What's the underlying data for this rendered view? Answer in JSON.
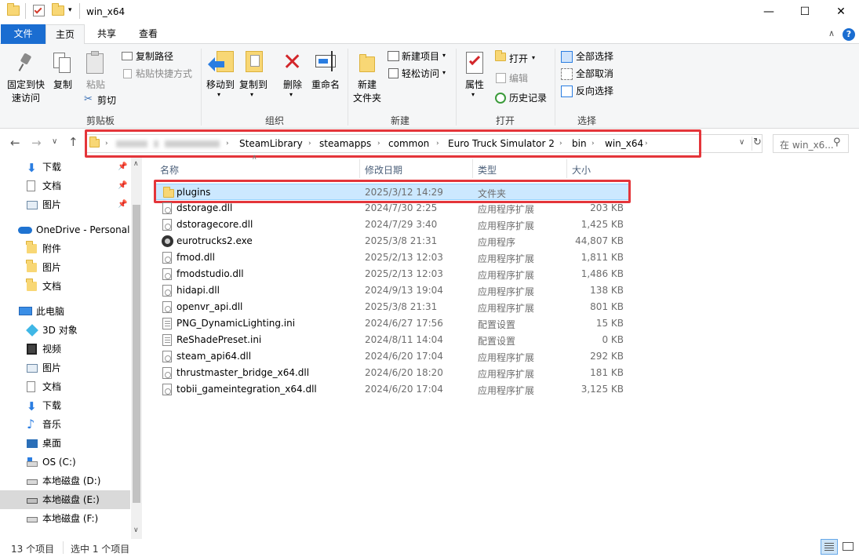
{
  "window": {
    "title": "win_x64",
    "min": "—",
    "max": "☐",
    "close": "✕"
  },
  "tabs": [
    {
      "label": "文件"
    },
    {
      "label": "主页"
    },
    {
      "label": "共享"
    },
    {
      "label": "查看"
    }
  ],
  "ribbon": {
    "clipboard": {
      "label": "剪贴板",
      "pin": "固定到快\n速访问",
      "copy": "复制",
      "paste": "粘贴",
      "copy_path": "复制路径",
      "paste_shortcut": "粘贴快捷方式",
      "cut": "剪切"
    },
    "organize": {
      "label": "组织",
      "move_to": "移动到",
      "copy_to": "复制到",
      "delete": "删除",
      "rename": "重命名"
    },
    "new": {
      "label": "新建",
      "new_folder": "新建\n文件夹",
      "new_item": "新建项目",
      "easy_access": "轻松访问"
    },
    "open": {
      "label": "打开",
      "properties": "属性",
      "open": "打开",
      "edit": "编辑",
      "history": "历史记录"
    },
    "select": {
      "label": "选择",
      "select_all": "全部选择",
      "select_none": "全部取消",
      "invert": "反向选择"
    }
  },
  "nav": {
    "back": "←",
    "forward": "→",
    "recent": "∨",
    "up": "↑",
    "breadcrumbs": [
      "SteamLibrary",
      "steamapps",
      "common",
      "Euro Truck Simulator 2",
      "bin",
      "win_x64"
    ],
    "search_placeholder": "在 win_x6..."
  },
  "sidebar": {
    "items": [
      {
        "label": "下载",
        "icon": "download-icon"
      },
      {
        "label": "文档",
        "icon": "document-icon"
      },
      {
        "label": "图片",
        "icon": "picture-icon"
      },
      {
        "label": "OneDrive - Personal",
        "icon": "onedrive-icon"
      },
      {
        "label": "附件",
        "icon": "folder-icon"
      },
      {
        "label": "图片",
        "icon": "folder-icon"
      },
      {
        "label": "文档",
        "icon": "folder-icon"
      },
      {
        "label": "此电脑",
        "icon": "computer-icon"
      },
      {
        "label": "3D 对象",
        "icon": "3d-objects-icon"
      },
      {
        "label": "视频",
        "icon": "video-icon"
      },
      {
        "label": "图片",
        "icon": "picture-icon"
      },
      {
        "label": "文档",
        "icon": "document-icon"
      },
      {
        "label": "下载",
        "icon": "download-icon"
      },
      {
        "label": "音乐",
        "icon": "music-icon"
      },
      {
        "label": "桌面",
        "icon": "desktop-icon"
      },
      {
        "label": "OS (C:)",
        "icon": "os-drive-icon"
      },
      {
        "label": "本地磁盘 (D:)",
        "icon": "drive-icon"
      },
      {
        "label": "本地磁盘 (E:)",
        "icon": "drive-icon"
      },
      {
        "label": "本地磁盘 (F:)",
        "icon": "drive-icon"
      }
    ]
  },
  "files": {
    "columns": {
      "name": "名称",
      "date": "修改日期",
      "type": "类型",
      "size": "大小"
    },
    "rows": [
      {
        "name": "plugins",
        "date": "2025/3/12 14:29",
        "type": "文件夹",
        "size": "",
        "icon": "folder-icon"
      },
      {
        "name": "dstorage.dll",
        "date": "2024/7/30 2:25",
        "type": "应用程序扩展",
        "size": "203 KB",
        "icon": "dll-icon"
      },
      {
        "name": "dstoragecore.dll",
        "date": "2024/7/29 3:40",
        "type": "应用程序扩展",
        "size": "1,425 KB",
        "icon": "dll-icon"
      },
      {
        "name": "eurotrucks2.exe",
        "date": "2025/3/8 21:31",
        "type": "应用程序",
        "size": "44,807 KB",
        "icon": "exe-icon"
      },
      {
        "name": "fmod.dll",
        "date": "2025/2/13 12:03",
        "type": "应用程序扩展",
        "size": "1,811 KB",
        "icon": "dll-icon"
      },
      {
        "name": "fmodstudio.dll",
        "date": "2025/2/13 12:03",
        "type": "应用程序扩展",
        "size": "1,486 KB",
        "icon": "dll-icon"
      },
      {
        "name": "hidapi.dll",
        "date": "2024/9/13 19:04",
        "type": "应用程序扩展",
        "size": "138 KB",
        "icon": "dll-icon"
      },
      {
        "name": "openvr_api.dll",
        "date": "2025/3/8 21:31",
        "type": "应用程序扩展",
        "size": "801 KB",
        "icon": "dll-icon"
      },
      {
        "name": "PNG_DynamicLighting.ini",
        "date": "2024/6/27 17:56",
        "type": "配置设置",
        "size": "15 KB",
        "icon": "ini-icon"
      },
      {
        "name": "ReShadePreset.ini",
        "date": "2024/8/11 14:04",
        "type": "配置设置",
        "size": "0 KB",
        "icon": "ini-icon"
      },
      {
        "name": "steam_api64.dll",
        "date": "2024/6/20 17:04",
        "type": "应用程序扩展",
        "size": "292 KB",
        "icon": "dll-icon"
      },
      {
        "name": "thrustmaster_bridge_x64.dll",
        "date": "2024/6/20 18:20",
        "type": "应用程序扩展",
        "size": "181 KB",
        "icon": "dll-icon"
      },
      {
        "name": "tobii_gameintegration_x64.dll",
        "date": "2024/6/20 17:04",
        "type": "应用程序扩展",
        "size": "3,125 KB",
        "icon": "dll-icon"
      }
    ]
  },
  "status": {
    "count": "13 个项目",
    "selected": "选中 1 个项目"
  },
  "colors": {
    "accent": "#1a6dd1",
    "highlight": "#cce8ff",
    "red_box": "#e4353a"
  }
}
